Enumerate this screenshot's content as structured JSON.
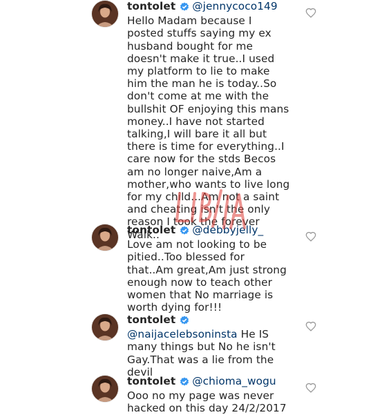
{
  "comments": [
    {
      "username": "tontolet",
      "mention": "@jennycoco149",
      "text": " Hello Madam because I posted stuffs saying my ex husband bought for me doesn't make it true..I used my platform to lie to make him the man he is today..So don't come at me with the bullshit OF enjoying this mans money..I have not started talking,I will bare it all but there is time for everything..I care now for the stds Becos am no longer naive,Am a mother,who wants to live long for my child...Am not a saint and cheating isn't the only reason I took the forever Walk..",
      "avatar_icon": "profile-photo",
      "like_icon": "heart-outline-icon"
    },
    {
      "username": "tontolet",
      "mention": "@debbyjelly_",
      "text": " Love am not looking to be pitied..Too blessed for that..Am great,Am just strong enough now to teach other women that No marriage is worth dying for!!!",
      "avatar_icon": "profile-photo",
      "like_icon": "heart-outline-icon"
    },
    {
      "username": "tontolet",
      "mention": "@naijacelebsoninsta",
      "text": " He IS many things but No he isn't Gay.That was a lie from the devil",
      "avatar_icon": "profile-photo",
      "like_icon": "heart-outline-icon"
    },
    {
      "username": "tontolet",
      "mention": "@chioma_wogu",
      "text": " Ooo no my page was never hacked on this day 24/2/2017",
      "avatar_icon": "profile-photo",
      "like_icon": "heart-outline-icon"
    }
  ],
  "watermark": "LIB/IA",
  "colors": {
    "text": "#262626",
    "mention": "#003569",
    "verified_badge": "#3897f0",
    "heart_outline": "#999999",
    "watermark": "#e0403a"
  }
}
